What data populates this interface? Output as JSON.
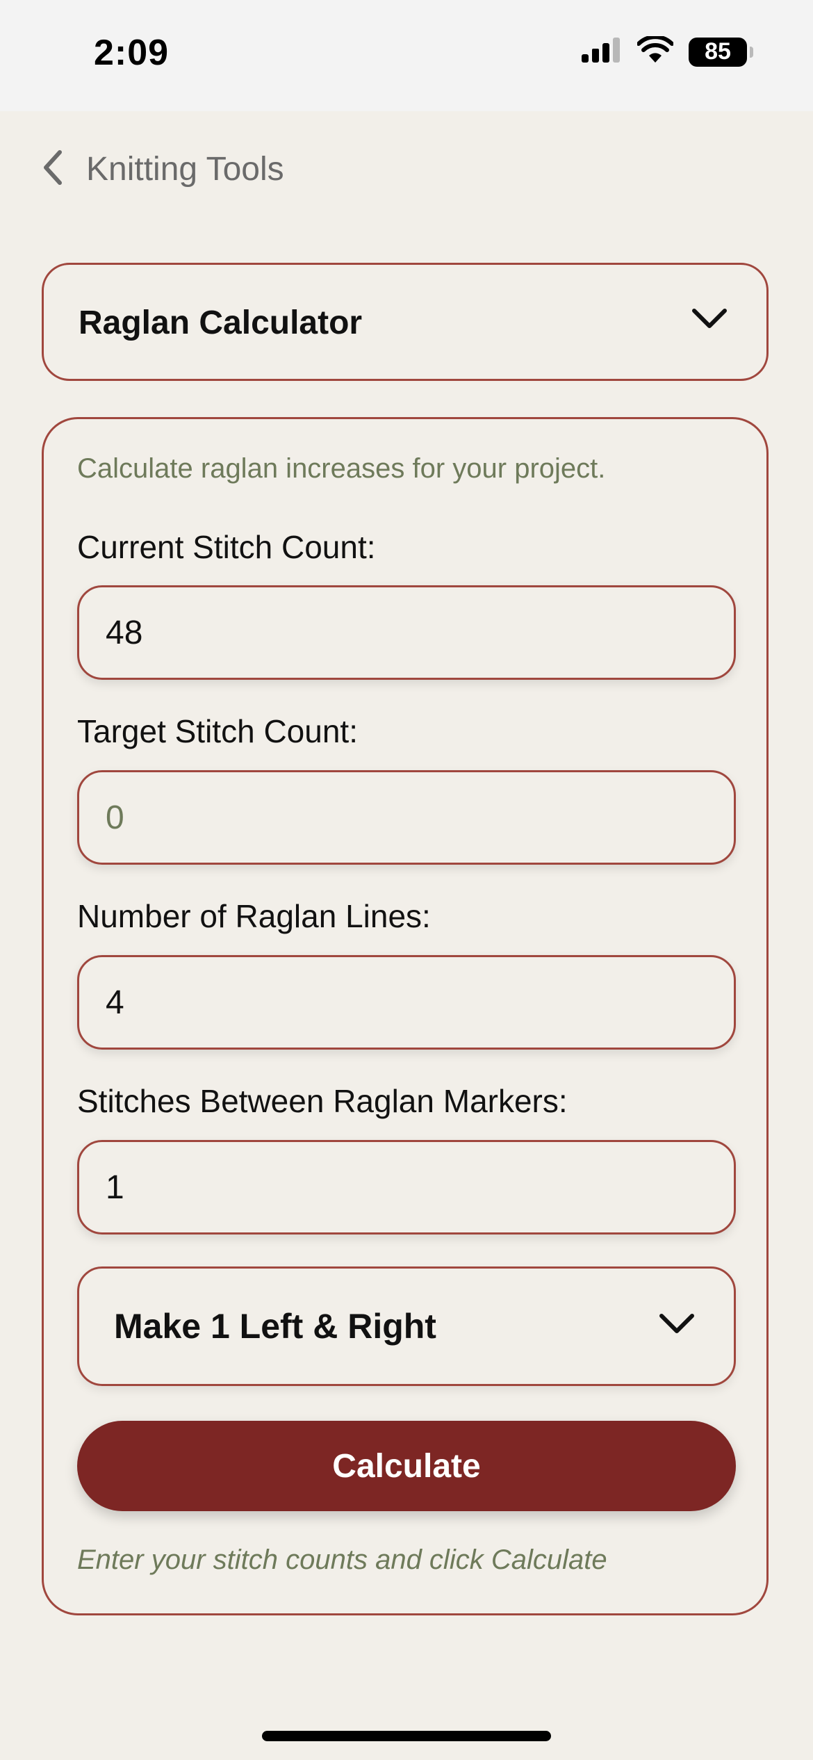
{
  "status_bar": {
    "time": "2:09",
    "battery": "85"
  },
  "nav": {
    "back_title": "Knitting Tools"
  },
  "tool_selector": {
    "selected": "Raglan Calculator"
  },
  "panel": {
    "description": "Calculate raglan increases for your project.",
    "fields": {
      "current": {
        "label": "Current Stitch Count:",
        "value": "48"
      },
      "target": {
        "label": "Target Stitch Count:",
        "placeholder": "0"
      },
      "lines": {
        "label": "Number of Raglan Lines:",
        "value": "4"
      },
      "between": {
        "label": "Stitches Between Raglan Markers:",
        "value": "1"
      }
    },
    "increase_method": {
      "selected": "Make 1 Left & Right"
    },
    "calculate_label": "Calculate",
    "result_text": "Enter your stitch counts and click Calculate"
  },
  "colors": {
    "accent": "#a0473e",
    "button": "#7d2624",
    "muted_text": "#6e7a5a",
    "background": "#f2efe9"
  }
}
